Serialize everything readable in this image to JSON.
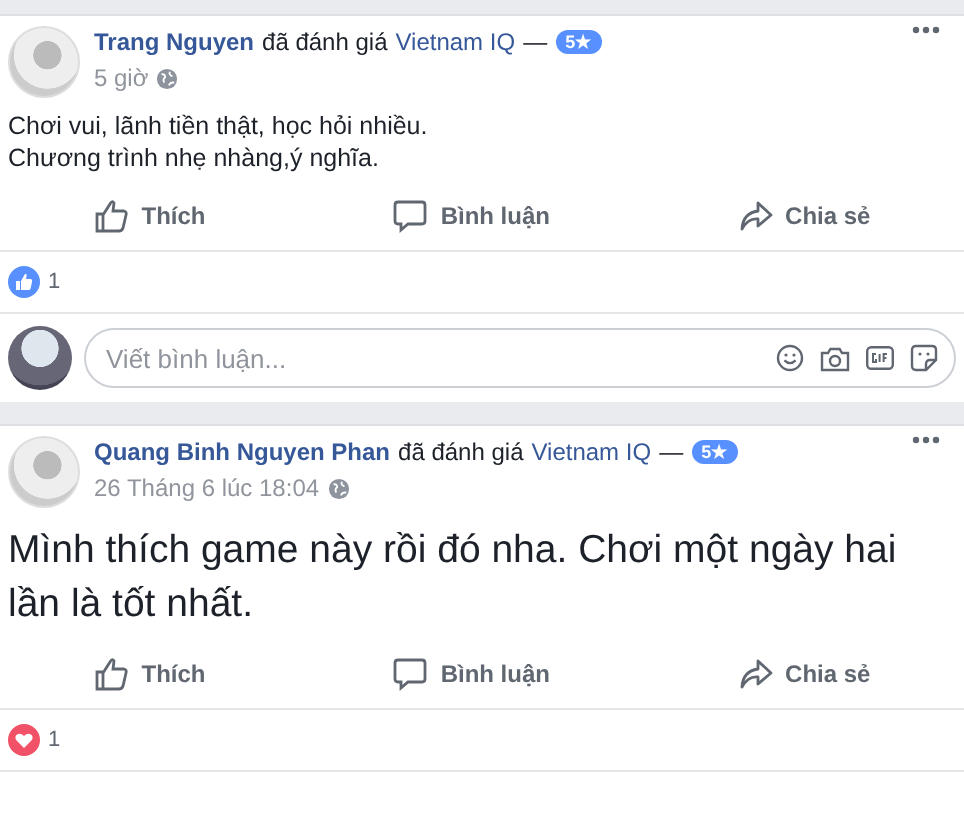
{
  "posts": [
    {
      "author": "Trang Nguyen",
      "action": "đã đánh giá",
      "page": "Vietnam IQ",
      "separator": "—",
      "rating": "5★",
      "time": "5 giờ",
      "kind": "text",
      "body": [
        "Chơi vui, lãnh tiền thật, học hỏi nhiều.",
        "Chương trình nhẹ nhàng,ý nghĩa."
      ],
      "actions": [
        "Thích",
        "Bình luận",
        "Chia sẻ"
      ],
      "reaction": {
        "kind": "like",
        "count": "1"
      },
      "comment_placeholder": "Viết bình luận..."
    },
    {
      "author": "Quang Binh Nguyen Phan",
      "action": "đã đánh giá",
      "page": "Vietnam IQ",
      "separator": "—",
      "rating": "5★",
      "time": "26 Tháng 6 lúc 18:04",
      "kind": "large_text",
      "body": [
        "Mình thích game này rồi đó nha. Chơi một ngày hai lần là tốt nhất."
      ],
      "actions": [
        "Thích",
        "Bình luận",
        "Chia sẻ"
      ],
      "reaction": {
        "kind": "love",
        "count": "1"
      }
    }
  ]
}
